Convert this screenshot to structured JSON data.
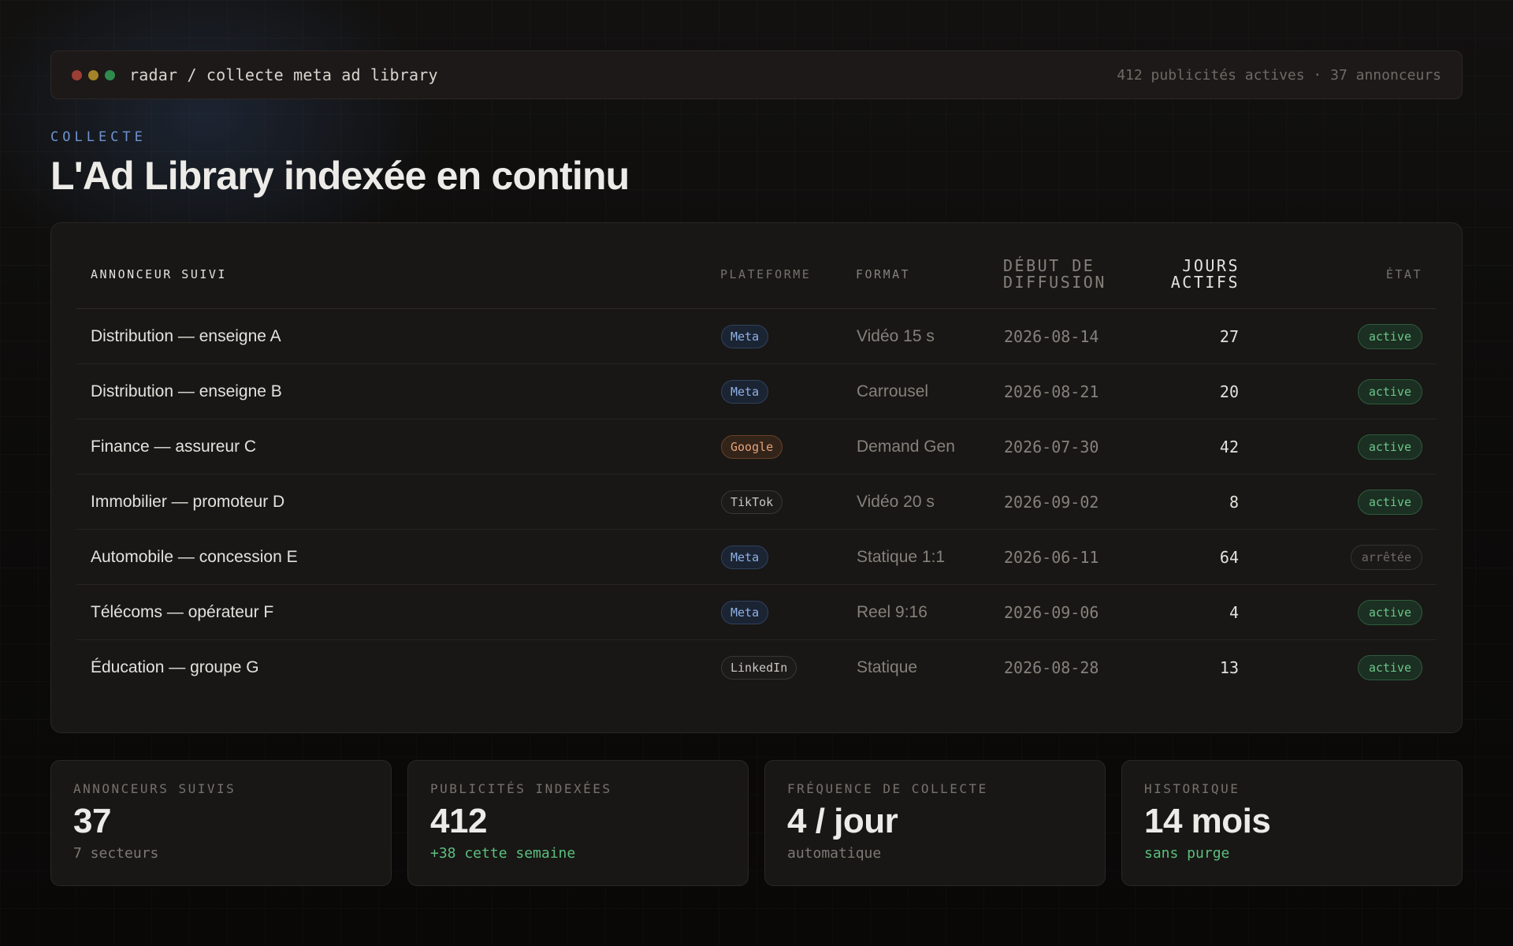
{
  "window": {
    "path": "radar / collecte meta ad library",
    "summary": "412 publicités actives · 37 annonceurs"
  },
  "header": {
    "eyebrow": "COLLECTE",
    "title": "L'Ad Library indexée en continu"
  },
  "table": {
    "columns": {
      "advertiser": "ANNONCEUR SUIVI",
      "platform": "PLATEFORME",
      "format": "FORMAT",
      "start_line1": "DÉBUT DE",
      "start_line2": "DIFFUSION",
      "days_line1": "JOURS",
      "days_line2": "ACTIFS",
      "state": "ÉTAT"
    },
    "rows": [
      {
        "advertiser": "Distribution — enseigne A",
        "platform": "Meta",
        "format": "Vidéo 15 s",
        "start": "2026-08-14",
        "days": "27",
        "state": "active"
      },
      {
        "advertiser": "Distribution — enseigne B",
        "platform": "Meta",
        "format": "Carrousel",
        "start": "2026-08-21",
        "days": "20",
        "state": "active"
      },
      {
        "advertiser": "Finance — assureur C",
        "platform": "Google",
        "format": "Demand Gen",
        "start": "2026-07-30",
        "days": "42",
        "state": "active"
      },
      {
        "advertiser": "Immobilier — promoteur D",
        "platform": "TikTok",
        "format": "Vidéo 20 s",
        "start": "2026-09-02",
        "days": "8",
        "state": "active"
      },
      {
        "advertiser": "Automobile — concession E",
        "platform": "Meta",
        "format": "Statique 1:1",
        "start": "2026-06-11",
        "days": "64",
        "state": "arrêtée"
      },
      {
        "advertiser": "Télécoms — opérateur F",
        "platform": "Meta",
        "format": "Reel 9:16",
        "start": "2026-09-06",
        "days": "4",
        "state": "active"
      },
      {
        "advertiser": "Éducation — groupe G",
        "platform": "LinkedIn",
        "format": "Statique",
        "start": "2026-08-28",
        "days": "13",
        "state": "active"
      }
    ]
  },
  "stats": [
    {
      "label": "ANNONCEURS SUIVIS",
      "value": "37",
      "sub": "7 secteurs",
      "sub_tone": "neutral"
    },
    {
      "label": "PUBLICITÉS INDEXÉES",
      "value": "412",
      "sub": "+38 cette semaine",
      "sub_tone": "positive"
    },
    {
      "label": "FRÉQUENCE DE COLLECTE",
      "value": "4 / jour",
      "sub": "automatique",
      "sub_tone": "neutral"
    },
    {
      "label": "HISTORIQUE",
      "value": "14 mois",
      "sub": "sans purge",
      "sub_tone": "positive"
    }
  ],
  "colors": {
    "accent_blue": "#6f93cf",
    "active_green": "#6cc68a",
    "google_orange": "#e5a37a",
    "meta_blue": "#8fb0e6"
  }
}
